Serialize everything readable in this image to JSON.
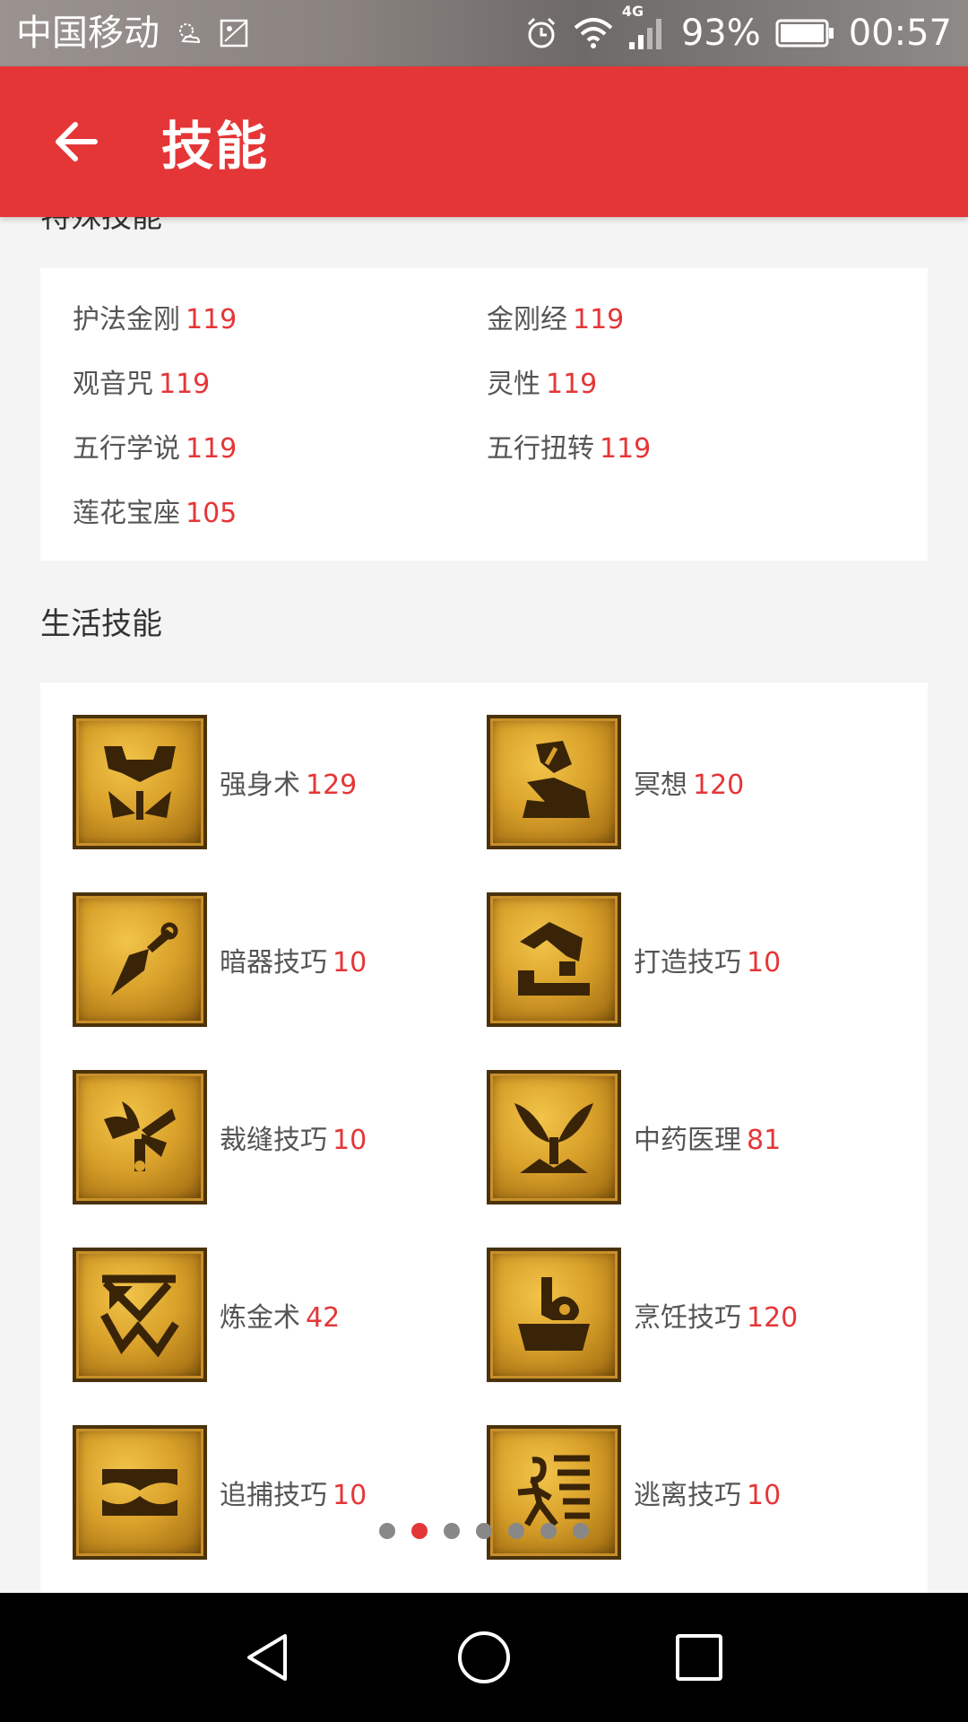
{
  "status_bar": {
    "carrier": "中国移动",
    "network": "4G",
    "battery": "93%",
    "time": "00:57"
  },
  "app_bar": {
    "title": "技能"
  },
  "special_skills": {
    "section_title_partial": "特殊技能",
    "items": [
      {
        "name": "护法金刚",
        "level": "119"
      },
      {
        "name": "金刚经",
        "level": "119"
      },
      {
        "name": "观音咒",
        "level": "119"
      },
      {
        "name": "灵性",
        "level": "119"
      },
      {
        "name": "五行学说",
        "level": "119"
      },
      {
        "name": "五行扭转",
        "level": "119"
      },
      {
        "name": "莲花宝座",
        "level": "105"
      }
    ]
  },
  "life_skills": {
    "section_title": "生活技能",
    "items": [
      {
        "name": "强身术",
        "level": "129",
        "icon": "strength-icon"
      },
      {
        "name": "冥想",
        "level": "120",
        "icon": "meditation-icon"
      },
      {
        "name": "暗器技巧",
        "level": "10",
        "icon": "dart-icon"
      },
      {
        "name": "打造技巧",
        "level": "10",
        "icon": "forging-icon"
      },
      {
        "name": "裁缝技巧",
        "level": "10",
        "icon": "tailoring-icon"
      },
      {
        "name": "中药医理",
        "level": "81",
        "icon": "herb-icon"
      },
      {
        "name": "炼金术",
        "level": "42",
        "icon": "alchemy-icon"
      },
      {
        "name": "烹饪技巧",
        "level": "120",
        "icon": "cooking-icon"
      },
      {
        "name": "追捕技巧",
        "level": "10",
        "icon": "tracking-icon"
      },
      {
        "name": "逃离技巧",
        "level": "10",
        "icon": "escape-icon"
      }
    ]
  },
  "pager": {
    "count": 7,
    "active_index": 1
  },
  "colors": {
    "accent": "#e53637",
    "level_text": "#e53637",
    "label_text": "#555555",
    "background": "#f4f4f4"
  }
}
